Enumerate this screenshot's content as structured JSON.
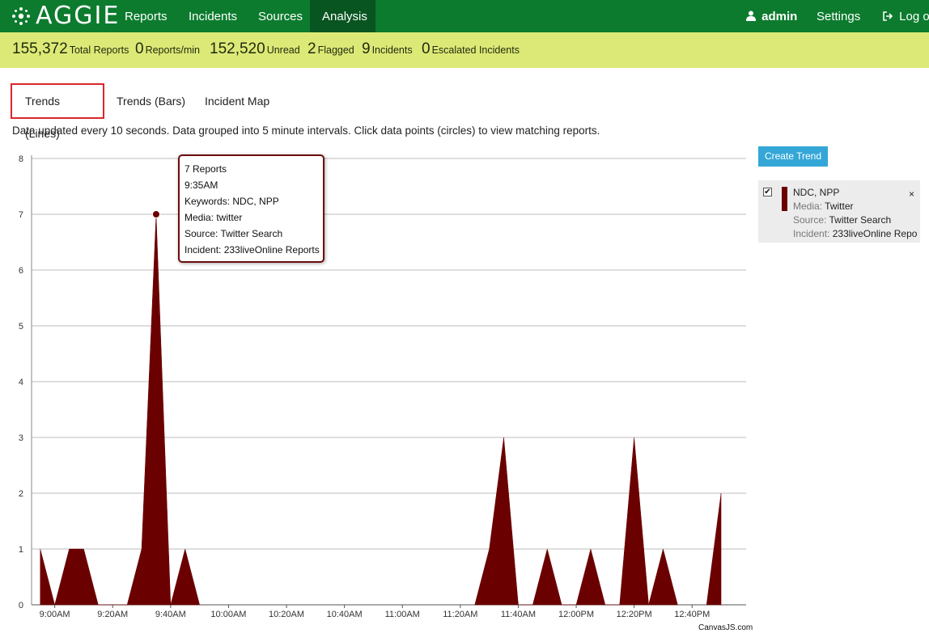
{
  "nav": {
    "brand": "AGGIE",
    "items": [
      {
        "label": "Reports"
      },
      {
        "label": "Incidents"
      },
      {
        "label": "Sources"
      },
      {
        "label": "Analysis",
        "active": true
      }
    ],
    "user": "admin",
    "settings": "Settings",
    "logout": "Log ou"
  },
  "stats": [
    {
      "value": "155,372",
      "label": "Total Reports"
    },
    {
      "value": "0",
      "label": "Reports/min"
    },
    {
      "value": "152,520",
      "label": "Unread"
    },
    {
      "value": "2",
      "label": "Flagged"
    },
    {
      "value": "9",
      "label": "Incidents"
    },
    {
      "value": "0",
      "label": "Escalated Incidents"
    }
  ],
  "tabs": [
    {
      "label": "Trends (Lines)",
      "active": true
    },
    {
      "label": "Trends (Bars)"
    },
    {
      "label": "Incident Map"
    }
  ],
  "info_text": "Data updated every 10 seconds. Data grouped into 5 minute intervals. Click data points (circles) to view matching reports.",
  "chart_data": {
    "type": "area",
    "x_tick_labels": [
      "9:00AM",
      "9:20AM",
      "9:40AM",
      "10:00AM",
      "10:20AM",
      "10:40AM",
      "11:00AM",
      "11:20AM",
      "11:40AM",
      "12:00PM",
      "12:20PM",
      "12:40PM"
    ],
    "y_ticks": [
      0,
      1,
      2,
      3,
      4,
      5,
      6,
      7,
      8
    ],
    "ylim": [
      0,
      8
    ],
    "grid": true,
    "series": [
      {
        "name": "NDC, NPP",
        "color": "#6b0000",
        "points": [
          [
            "8:55AM",
            1
          ],
          [
            "9:00AM",
            0
          ],
          [
            "9:05AM",
            1
          ],
          [
            "9:10AM",
            1
          ],
          [
            "9:15AM",
            0
          ],
          [
            "9:20AM",
            0
          ],
          [
            "9:25AM",
            0
          ],
          [
            "9:30AM",
            1
          ],
          [
            "9:35AM",
            7
          ],
          [
            "9:40AM",
            0
          ],
          [
            "9:45AM",
            1
          ],
          [
            "9:50AM",
            0
          ],
          [
            "11:25AM",
            0
          ],
          [
            "11:30AM",
            1
          ],
          [
            "11:35AM",
            3
          ],
          [
            "11:40AM",
            0
          ],
          [
            "11:45AM",
            0
          ],
          [
            "11:50AM",
            1
          ],
          [
            "11:55AM",
            0
          ],
          [
            "12:00PM",
            0
          ],
          [
            "12:05PM",
            1
          ],
          [
            "12:10PM",
            0
          ],
          [
            "12:15PM",
            0
          ],
          [
            "12:20PM",
            3
          ],
          [
            "12:25PM",
            0
          ],
          [
            "12:30PM",
            1
          ],
          [
            "12:35PM",
            0
          ],
          [
            "12:45PM",
            0
          ],
          [
            "12:50PM",
            2
          ]
        ]
      }
    ],
    "credit": "CanvasJS.com"
  },
  "tooltip": {
    "lines": [
      "7 Reports",
      "9:35AM",
      "Keywords: NDC, NPP",
      "Media: twitter",
      "Source: Twitter Search",
      "Incident: 233liveOnline Reports"
    ]
  },
  "create_trend_label": "Create Trend",
  "trend_card": {
    "checked": true,
    "check_glyph": "✔",
    "keywords": "NDC, NPP",
    "media_key": "Media:",
    "media_val": "Twitter",
    "source_key": "Source:",
    "source_val": "Twitter Search",
    "incident_key": "Incident:",
    "incident_val": "233liveOnline Repo",
    "close": "×"
  }
}
